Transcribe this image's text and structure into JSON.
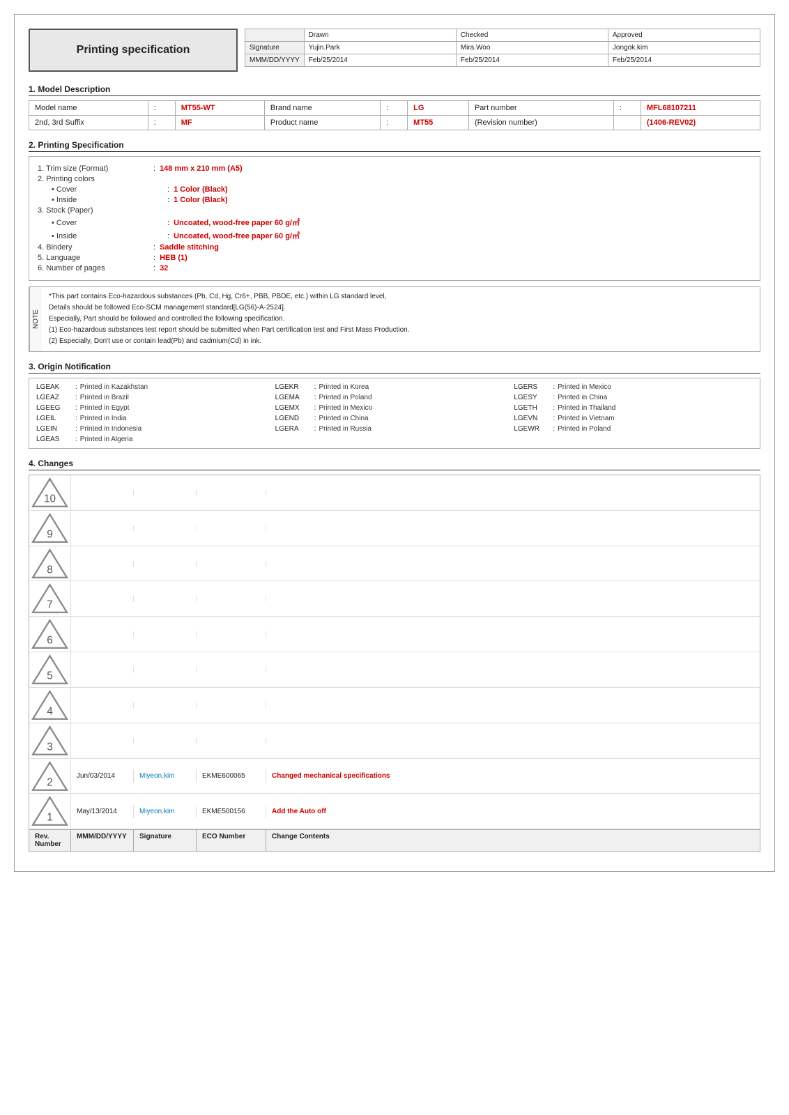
{
  "header": {
    "title": "Printing specification",
    "table": {
      "columns": [
        "",
        "Drawn",
        "Checked",
        "Approved"
      ],
      "rows": [
        [
          "Signature",
          "Yujin.Park",
          "Mira.Woo",
          "Jongok.kim"
        ],
        [
          "MMM/DD/YYYY",
          "Feb/25/2014",
          "Feb/25/2014",
          "Feb/25/2014"
        ]
      ]
    }
  },
  "section1": {
    "title": "1. Model Description",
    "rows": [
      {
        "label": "Model name",
        "colon": ":",
        "value": "MT55-WT",
        "label2": "Brand name",
        "colon2": ":",
        "value2": "LG",
        "label3": "Part number",
        "colon3": ":",
        "value3": "MFL68107211"
      },
      {
        "label": "2nd, 3rd Suffix",
        "colon": ":",
        "value": "MF",
        "label2": "Product name",
        "colon2": ":",
        "value2": "MT55",
        "label3": "(Revision number)",
        "colon3": "",
        "value3": "(1406-REV02)"
      }
    ]
  },
  "section2": {
    "title": "2. Printing Specification",
    "items": [
      {
        "num": "1.",
        "label": "Trim size (Format)",
        "colon": ":",
        "value": "148 mm x 210 mm (A5)",
        "indent": 0
      },
      {
        "num": "2.",
        "label": "Printing colors",
        "colon": "",
        "value": "",
        "indent": 0
      },
      {
        "num": "•",
        "label": "Cover",
        "colon": ":",
        "value": "1 Color (Black)",
        "indent": 1
      },
      {
        "num": "•",
        "label": "Inside",
        "colon": ":",
        "value": "1 Color (Black)",
        "indent": 1
      },
      {
        "num": "3.",
        "label": "Stock (Paper)",
        "colon": "",
        "value": "",
        "indent": 0
      },
      {
        "num": "•",
        "label": "Cover",
        "colon": ":",
        "value": "Uncoated, wood-free paper 60 g/㎡",
        "indent": 1
      },
      {
        "num": "•",
        "label": "Inside",
        "colon": ":",
        "value": "Uncoated, wood-free paper 60 g/㎡",
        "indent": 1
      },
      {
        "num": "4.",
        "label": "Bindery",
        "colon": ":",
        "value": "Saddle stitching",
        "indent": 0
      },
      {
        "num": "5.",
        "label": "Language",
        "colon": ":",
        "value": "HEB (1)",
        "indent": 0
      },
      {
        "num": "6.",
        "label": "Number of pages",
        "colon": ":",
        "value": "32",
        "indent": 0
      }
    ]
  },
  "note": {
    "side_label": "NOTE",
    "lines": [
      "*This part contains Eco-hazardous substances (Pb, Cd, Hg, Cr6+, PBB, PBDE, etc.) within LG standard level,",
      "Details should be followed Eco-SCM management standard[LG(56)-A-2524].",
      "Especially, Part should be followed and controlled the following specification.",
      "(1) Eco-hazardous substances test report should be submitted when Part certification test and First Mass Production.",
      "(2) Especially, Don't use or contain lead(Pb) and cadmium(Cd) in ink."
    ]
  },
  "section3": {
    "title": "3. Origin Notification",
    "entries": [
      {
        "code": "LGEAK",
        "sep": ":",
        "desc": "Printed in Kazakhstan"
      },
      {
        "code": "LGEKR",
        "sep": ":",
        "desc": "Printed in Korea"
      },
      {
        "code": "LGERS",
        "sep": ":",
        "desc": "Printed in Mexico"
      },
      {
        "code": "LGEAZ",
        "sep": ":",
        "desc": "Printed in Brazil"
      },
      {
        "code": "LGEMA",
        "sep": ":",
        "desc": "Printed in Poland"
      },
      {
        "code": "LGESY",
        "sep": ":",
        "desc": "Printed in China"
      },
      {
        "code": "LGEEG",
        "sep": ":",
        "desc": "Printed in Egypt"
      },
      {
        "code": "LGEMX",
        "sep": ":",
        "desc": "Printed in Mexico"
      },
      {
        "code": "LGETH",
        "sep": ":",
        "desc": "Printed in Thailand"
      },
      {
        "code": "LGEIL",
        "sep": ":",
        "desc": "Printed in India"
      },
      {
        "code": "LGEND",
        "sep": ":",
        "desc": "Printed in China"
      },
      {
        "code": "LGEVN",
        "sep": ":",
        "desc": "Printed in Vietnam"
      },
      {
        "code": "LGEIN",
        "sep": ":",
        "desc": "Printed in Indonesia"
      },
      {
        "code": "LGERA",
        "sep": ":",
        "desc": "Printed in Russia"
      },
      {
        "code": "LGEWR",
        "sep": ":",
        "desc": "Printed in Poland"
      },
      {
        "code": "LGEAS",
        "sep": ":",
        "desc": "Printed in Algeria"
      },
      {
        "code": "",
        "sep": "",
        "desc": ""
      },
      {
        "code": "",
        "sep": "",
        "desc": ""
      }
    ]
  },
  "section4": {
    "title": "4. Changes",
    "rows": [
      {
        "rev": "10",
        "date": "",
        "signature": "",
        "eco": "",
        "content": ""
      },
      {
        "rev": "9",
        "date": "",
        "signature": "",
        "eco": "",
        "content": ""
      },
      {
        "rev": "8",
        "date": "",
        "signature": "",
        "eco": "",
        "content": ""
      },
      {
        "rev": "7",
        "date": "",
        "signature": "",
        "eco": "",
        "content": ""
      },
      {
        "rev": "6",
        "date": "",
        "signature": "",
        "eco": "",
        "content": ""
      },
      {
        "rev": "5",
        "date": "",
        "signature": "",
        "eco": "",
        "content": ""
      },
      {
        "rev": "4",
        "date": "",
        "signature": "",
        "eco": "",
        "content": ""
      },
      {
        "rev": "3",
        "date": "",
        "signature": "",
        "eco": "",
        "content": ""
      },
      {
        "rev": "2",
        "date": "Jun/03/2014",
        "signature": "Miyeon.kim",
        "eco": "EKME600065",
        "content": "Changed mechanical specifications"
      },
      {
        "rev": "1",
        "date": "May/13/2014",
        "signature": "Miyeon.kim",
        "eco": "EKME500156",
        "content": "Add the Auto off"
      }
    ],
    "footer": {
      "rev_label": "Rev. Number",
      "date_label": "MMM/DD/YYYY",
      "sig_label": "Signature",
      "eco_label": "ECO Number",
      "content_label": "Change Contents"
    }
  }
}
